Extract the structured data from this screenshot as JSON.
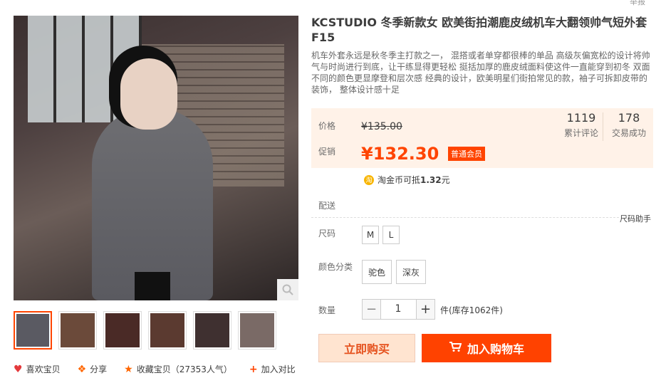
{
  "header": {
    "report": "举报"
  },
  "gallery": {
    "thumb_colors": [
      "#5a5a62",
      "#6b4a3a",
      "#4a2a26",
      "#5b3a30",
      "#3f3030",
      "#7a6a66"
    ],
    "actions": {
      "like": "喜欢宝贝",
      "share": "分享",
      "favorite": "收藏宝贝（27353人气）",
      "compare": "加入对比"
    }
  },
  "product": {
    "title": "KCSTUDIO 冬季新款女 欧美街拍潮鹿皮绒机车大翻领帅气短外套F15",
    "description": "机车外套永远是秋冬季主打款之一， 混搭或者单穿都很棒的单品 高级灰偏宽松的设计将帅气与时尚进行到底，让干练显得更轻松 挺括加厚的鹿皮绒面料使这件一直能穿到初冬 双面不同的颜色更显摩登和层次感 经典的设计，欧美明星们街拍常见的款，袖子可拆卸皮带的装饰， 整体设计感十足"
  },
  "price": {
    "price_label": "价格",
    "original": "¥135.00",
    "promo_label": "促销",
    "promo": "¥132.30",
    "member_badge": "普通会员",
    "coin_icon": "淘",
    "coin_text": "淘金币可抵",
    "coin_value": "1.32",
    "coin_unit": "元"
  },
  "stats": {
    "reviews_count": "1119",
    "reviews_label": "累计评论",
    "deals_count": "178",
    "deals_label": "交易成功"
  },
  "delivery": {
    "label": "配送"
  },
  "size": {
    "label": "尺码",
    "help": "尺码助手",
    "options": [
      "M",
      "L"
    ]
  },
  "color": {
    "label": "颜色分类",
    "options": [
      "驼色",
      "深灰"
    ]
  },
  "quantity": {
    "label": "数量",
    "value": "1",
    "minus": "−",
    "plus": "+",
    "stock": "件(库存1062件)"
  },
  "buttons": {
    "buy_now": "立即购买",
    "add_cart": "加入购物车"
  },
  "colors": {
    "accent": "#ff4400",
    "price_bg": "#fff2e8"
  }
}
